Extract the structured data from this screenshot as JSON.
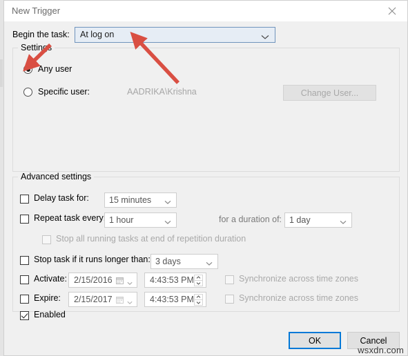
{
  "window": {
    "title": "New Trigger",
    "close_icon": "close-icon"
  },
  "begin_task": {
    "label": "Begin the task:",
    "value": "At log on"
  },
  "settings": {
    "legend": "Settings",
    "any_user": {
      "label": "Any user",
      "checked": true
    },
    "specific_user": {
      "label": "Specific user:",
      "checked": false,
      "value": "AADRIKA\\Krishna"
    },
    "change_user_button": "Change User..."
  },
  "advanced": {
    "legend": "Advanced settings",
    "delay_task": {
      "label": "Delay task for:",
      "checked": false,
      "value": "15 minutes"
    },
    "repeat_task": {
      "label": "Repeat task every:",
      "checked": false,
      "value": "1 hour"
    },
    "duration": {
      "label": "for a duration of:",
      "value": "1 day"
    },
    "stop_all_running": {
      "label": "Stop all running tasks at end of repetition duration",
      "checked": false
    },
    "stop_task_longer": {
      "label": "Stop task if it runs longer than:",
      "checked": false,
      "value": "3 days"
    },
    "activate": {
      "label": "Activate:",
      "checked": false,
      "date": "2/15/2016",
      "time": "4:43:53 PM",
      "sync_label": "Synchronize across time zones",
      "sync_checked": false
    },
    "expire": {
      "label": "Expire:",
      "checked": false,
      "date": "2/15/2017",
      "time": "4:43:53 PM",
      "sync_label": "Synchronize across time zones",
      "sync_checked": false
    },
    "enabled": {
      "label": "Enabled",
      "checked": true
    }
  },
  "footer": {
    "ok": "OK",
    "cancel": "Cancel"
  },
  "watermark": "wsxdn.com",
  "colors": {
    "accent": "#0078d7",
    "annotation": "#d94f43",
    "dialog_bg": "#f0f0f0",
    "combo_focus_bg": "#e6edf5"
  }
}
